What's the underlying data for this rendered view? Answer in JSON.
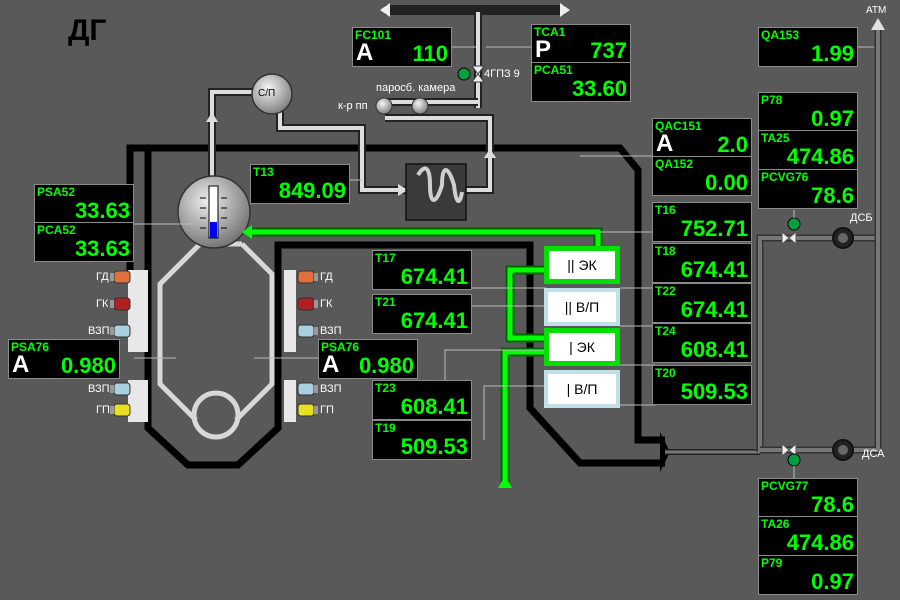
{
  "title": "ДГ",
  "labels": {
    "sp": "С/П",
    "fc_valve": "4ГПЗ 9",
    "steam_chamber": "паросб. камера",
    "kr_pp": "к-р пп",
    "atm": "АТМ",
    "dsb": "ДСБ",
    "dsa": "ДСА"
  },
  "burners_left": [
    "ГД",
    "ГК",
    "ВЗП",
    "ВЗП",
    "ГП"
  ],
  "burners_right": [
    "ГД",
    "ГК",
    "ВЗП",
    "ВЗП",
    "ГП"
  ],
  "sections": [
    "|| ЭК",
    "|| В/П",
    "| ЭК",
    "| В/П"
  ],
  "tags": {
    "fc101": {
      "name": "FC101",
      "mode": "A",
      "value": "110"
    },
    "tca1": {
      "name": "TCA1",
      "mode": "P",
      "value": "737"
    },
    "pca51": {
      "name": "PCA51",
      "value": "33.60"
    },
    "qa153": {
      "name": "QA153",
      "value": "1.99"
    },
    "p78": {
      "name": "P78",
      "value": "0.97"
    },
    "ta25": {
      "name": "TA25",
      "value": "474.86"
    },
    "pcvg76": {
      "name": "PCVG76",
      "value": "78.6"
    },
    "qac151": {
      "name": "QAC151",
      "mode": "A",
      "value": "2.0"
    },
    "qa152": {
      "name": "QA152",
      "value": "0.00"
    },
    "t13": {
      "name": "T13",
      "value": "849.09"
    },
    "psa52": {
      "name": "PSA52",
      "value": "33.63"
    },
    "pca52": {
      "name": "PCA52",
      "value": "33.63"
    },
    "t16": {
      "name": "T16",
      "value": "752.71"
    },
    "t17": {
      "name": "T17",
      "value": "674.41"
    },
    "t18": {
      "name": "T18",
      "value": "674.41"
    },
    "t21": {
      "name": "T21",
      "value": "674.41"
    },
    "t22": {
      "name": "T22",
      "value": "674.41"
    },
    "t24": {
      "name": "T24",
      "value": "608.41"
    },
    "t20": {
      "name": "T20",
      "value": "509.53"
    },
    "t23": {
      "name": "T23",
      "value": "608.41"
    },
    "t19": {
      "name": "T19",
      "value": "509.53"
    },
    "psa76_l": {
      "name": "PSA76",
      "mode": "A",
      "value": "0.980"
    },
    "psa76_r": {
      "name": "PSA76",
      "mode": "A",
      "value": "0.980"
    },
    "pcvg77": {
      "name": "PCVG77",
      "value": "78.6"
    },
    "ta26": {
      "name": "TA26",
      "value": "474.86"
    },
    "p79": {
      "name": "P79",
      "value": "0.97"
    }
  },
  "colors": {
    "background": "#595959",
    "value_green": "#00ff00",
    "hot_flow": "#00e000",
    "gd": "#e07040",
    "gk": "#b02020",
    "vzp": "#a8d0e0",
    "gp": "#e8e020"
  }
}
